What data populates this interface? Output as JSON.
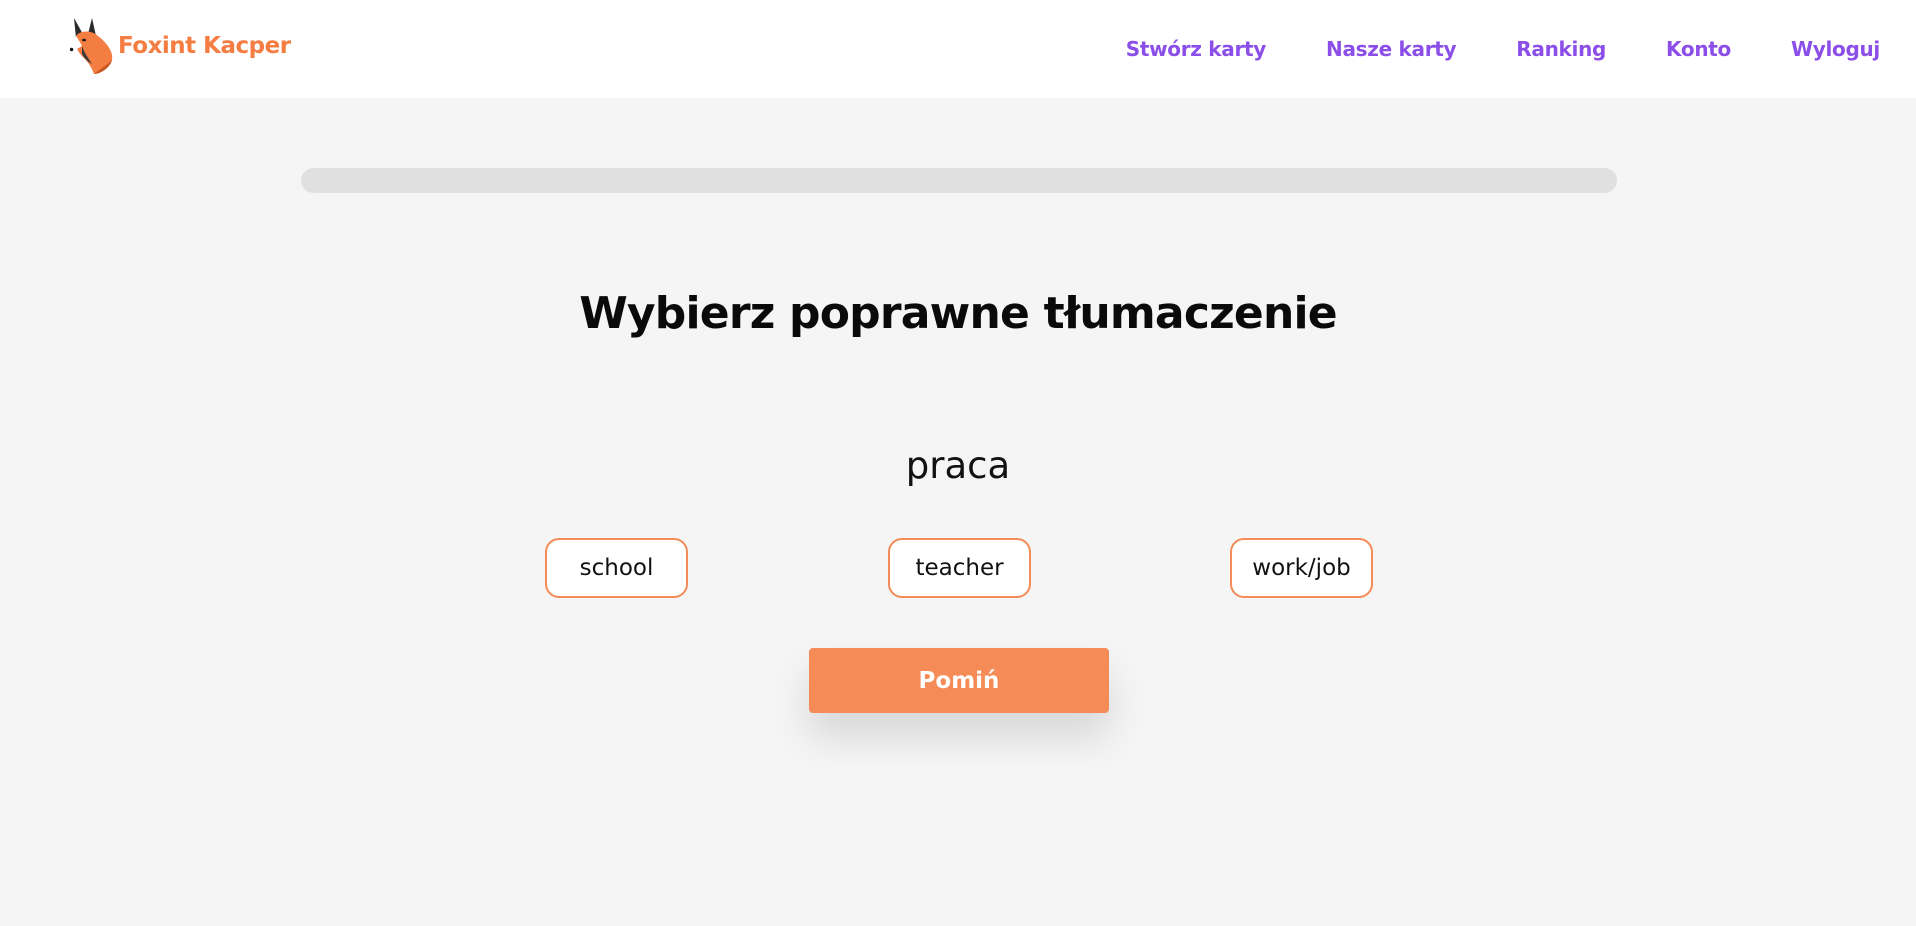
{
  "header": {
    "logo_text": "Foxint Kacper",
    "logo_icon": "fox-head-icon",
    "nav": [
      {
        "label": "Stwórz karty"
      },
      {
        "label": "Nasze karty"
      },
      {
        "label": "Ranking"
      },
      {
        "label": "Konto"
      },
      {
        "label": "Wyloguj"
      }
    ]
  },
  "progress": {
    "value": 0
  },
  "quiz": {
    "title": "Wybierz poprawne tłumaczenie",
    "word": "praca",
    "options": [
      {
        "label": "school"
      },
      {
        "label": "teacher"
      },
      {
        "label": "work/job"
      }
    ],
    "skip_label": "Pomiń"
  },
  "colors": {
    "accent": "#f58c57",
    "nav_link": "#8b4ee8",
    "background": "#f5f5f5",
    "progress_track": "#e0e0e0"
  }
}
